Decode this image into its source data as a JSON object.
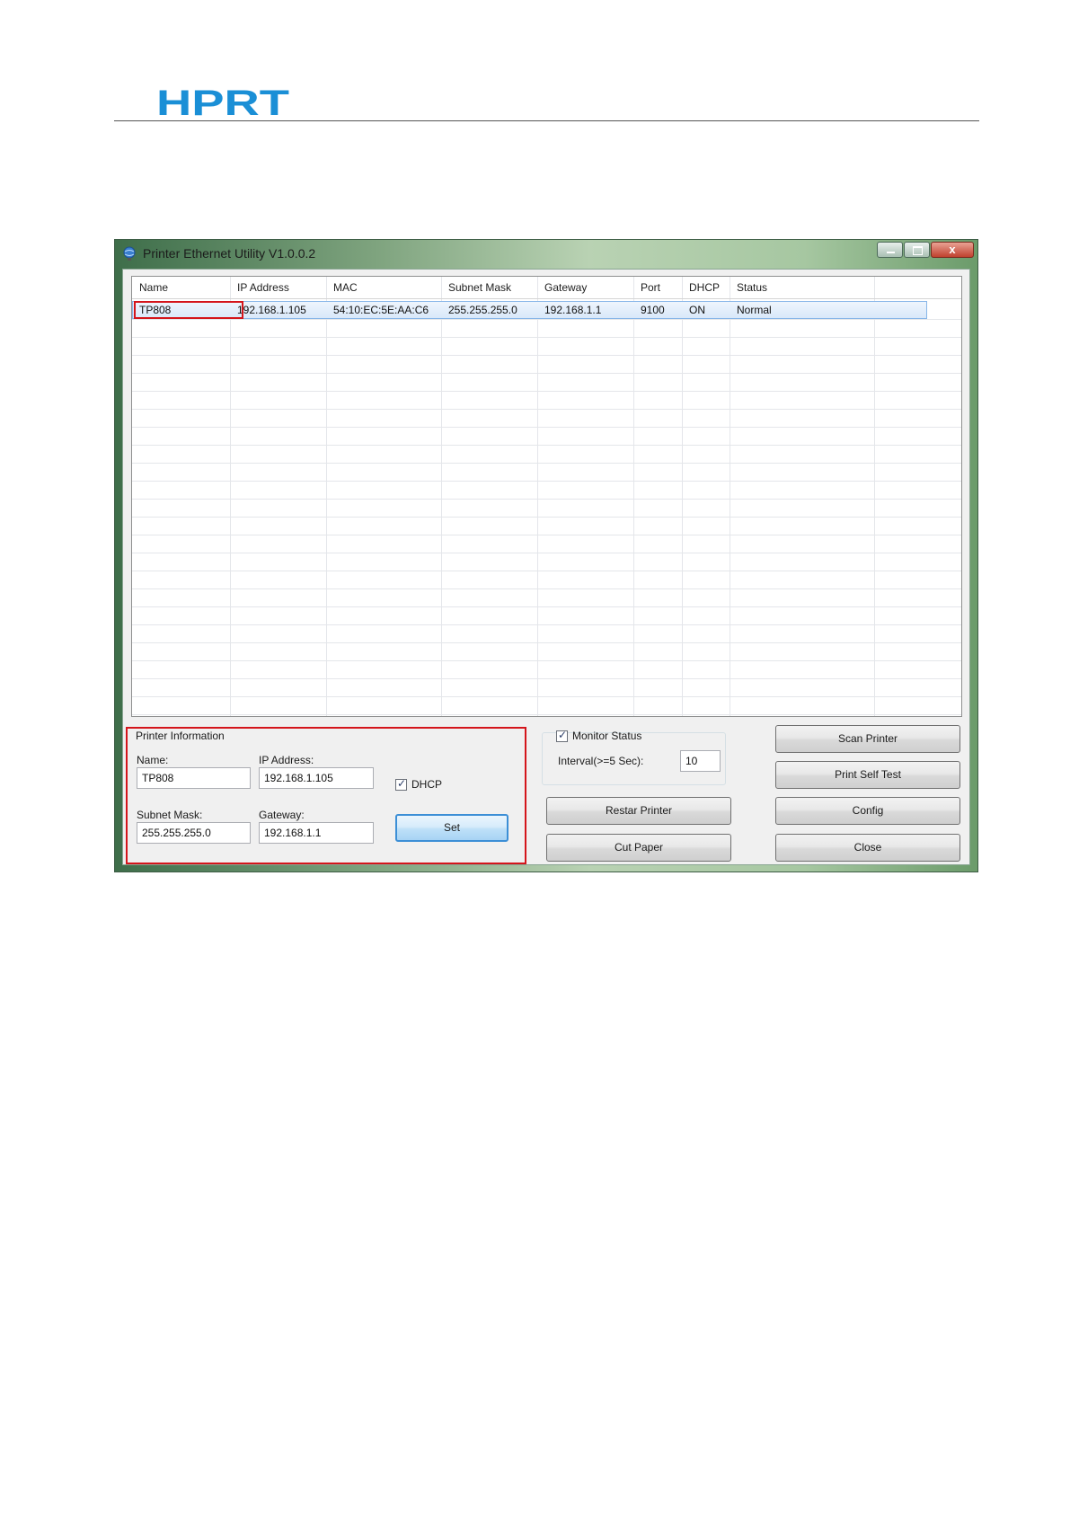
{
  "logo": {
    "text": "HPRT",
    "color": "#1a8fd6"
  },
  "window": {
    "title": "Printer Ethernet Utility  V1.0.0.2",
    "close_glyph": "x",
    "icons": [
      "app-globe-icon",
      "minimize-icon",
      "maximize-icon",
      "close-icon"
    ]
  },
  "table": {
    "columns": [
      "Name",
      "IP Address",
      "MAC",
      "Subnet Mask",
      "Gateway",
      "Port",
      "DHCP",
      "Status"
    ],
    "rows": [
      [
        "TP808",
        "192.168.1.105",
        "54:10:EC:5E:AA:C6",
        "255.255.255.0",
        "192.168.1.1",
        "9100",
        "ON",
        "Normal"
      ]
    ]
  },
  "printer_info": {
    "legend": "Printer Information",
    "name_label": "Name:",
    "name_value": "TP808",
    "ip_label": "IP Address:",
    "ip_value": "192.168.1.105",
    "dhcp_label": "DHCP",
    "dhcp_checked": true,
    "subnet_label": "Subnet Mask:",
    "subnet_value": "255.255.255.0",
    "gateway_label": "Gateway:",
    "gateway_value": "192.168.1.1",
    "set_label": "Set"
  },
  "monitor": {
    "label": "Monitor Status",
    "checked": true,
    "interval_label": "Interval(>=5 Sec):",
    "interval_value": "10"
  },
  "buttons": {
    "restart": "Restar Printer",
    "cut_paper": "Cut Paper",
    "scan": "Scan Printer",
    "self_test": "Print Self Test",
    "config": "Config",
    "close": "Close"
  },
  "colors": {
    "highlight_red": "#d4151b",
    "selection_blue": "#88b6e8"
  }
}
